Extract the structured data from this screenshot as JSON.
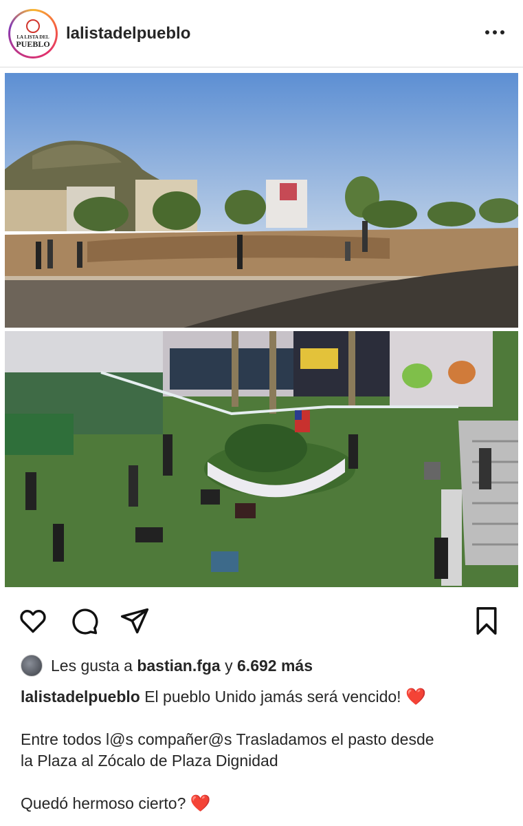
{
  "header": {
    "username": "lalistadelpueblo",
    "logo_line1": "LA LISTA DEL",
    "logo_line2": "PUEBLO",
    "more_icon": "more-horizontal-icon"
  },
  "photos": {
    "top_alt": "",
    "bottom_alt": ""
  },
  "actions": {
    "like_icon": "heart-outline-icon",
    "comment_icon": "comment-bubble-icon",
    "share_icon": "paper-plane-icon",
    "save_icon": "bookmark-icon"
  },
  "likes": {
    "prefix": "Les gusta a",
    "user": "bastian.fga",
    "middle": "y",
    "count": "6.692 más"
  },
  "caption": {
    "author": "lalistadelpueblo",
    "line1": "El pueblo Unido jamás será vencido!",
    "emoji1": "❤️",
    "line2a": "Entre todos l@s compañer@s Trasladamos el pasto desde",
    "line2b": "la Plaza al Zócalo de Plaza Dignidad",
    "line3": "Quedó hermoso cierto?",
    "emoji2": "❤️"
  },
  "colors": {
    "heart": "#e0312c",
    "text": "#262626",
    "sky": "#7aa3d6",
    "grass": "#4f7a3a"
  }
}
